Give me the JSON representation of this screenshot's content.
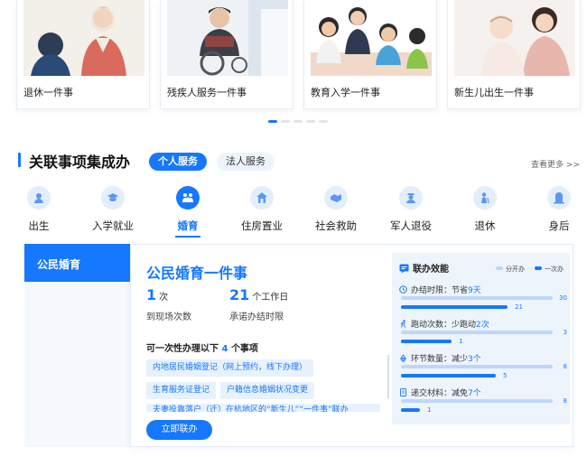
{
  "cards": [
    {
      "label": "退休一件事",
      "scene": "retire"
    },
    {
      "label": "残疾人服务一件事",
      "scene": "disabled"
    },
    {
      "label": "教育入学一件事",
      "scene": "education"
    },
    {
      "label": "新生儿出生一件事",
      "scene": "newborn"
    }
  ],
  "carousel": {
    "total": 5,
    "active": 1
  },
  "section": {
    "title": "关联事项集成办",
    "tabs": [
      {
        "label": "个人服务",
        "active": true
      },
      {
        "label": "法人服务",
        "active": false
      }
    ],
    "more": "查看更多 >>"
  },
  "categories": [
    {
      "label": "出生",
      "icon": "baby-icon"
    },
    {
      "label": "入学就业",
      "icon": "graduation-cap-icon"
    },
    {
      "label": "婚育",
      "icon": "family-icon",
      "active": true
    },
    {
      "label": "住房置业",
      "icon": "house-icon"
    },
    {
      "label": "社会救助",
      "icon": "handshake-icon"
    },
    {
      "label": "军人退役",
      "icon": "soldier-icon"
    },
    {
      "label": "退休",
      "icon": "elder-icon"
    },
    {
      "label": "身后",
      "icon": "memorial-icon"
    }
  ],
  "sidebar": {
    "active_item": "公民婚育"
  },
  "panel": {
    "title": "公民婚育一件事",
    "visits": {
      "value": "1",
      "unit": "次",
      "desc": "到现场次数"
    },
    "time_limit": {
      "value": "21",
      "unit": "个工作日",
      "desc": "承诺办结时限"
    },
    "once_prefix": "可一次性办理以下",
    "once_count": "4",
    "once_suffix": "个事项",
    "tags": [
      "内地居民婚姻登记（网上预约，线下办理）",
      "生育服务证登记",
      "户籍信息婚姻状况变更",
      "夫妻投靠落户（迁）在杭地区的“新生儿”“一件事”联办"
    ],
    "button": "立即联办"
  },
  "efficiency": {
    "title": "联办效能",
    "legend": {
      "separate": "分开办",
      "once": "一次办"
    },
    "colors": {
      "separate": "#bcd7fb",
      "once": "#1677ff"
    },
    "rows": [
      {
        "label": "办结时限：节省",
        "highlight": "9天",
        "separate": 30,
        "once": 21,
        "max": 30,
        "icon": "clock-icon"
      },
      {
        "label": "跑动次数：少跑动",
        "highlight": "2次",
        "separate": 3,
        "once": 1,
        "max": 3,
        "icon": "run-icon"
      },
      {
        "label": "环节数量：减少",
        "highlight": "3个",
        "separate": 8,
        "once": 5,
        "max": 8,
        "icon": "recycle-icon"
      },
      {
        "label": "递交材料：减免",
        "highlight": "7个",
        "separate": 8,
        "once": 1,
        "max": 8,
        "icon": "document-icon"
      }
    ]
  }
}
